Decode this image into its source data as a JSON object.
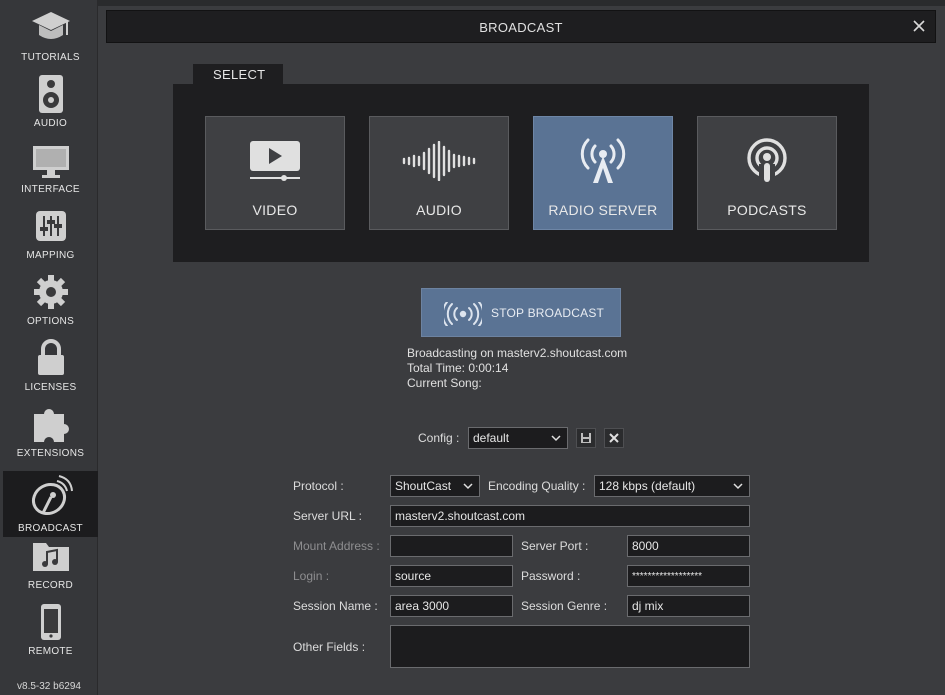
{
  "sidebar": {
    "items": [
      {
        "label": "TUTORIALS",
        "icon": "graduation-cap-icon"
      },
      {
        "label": "AUDIO",
        "icon": "speaker-icon"
      },
      {
        "label": "INTERFACE",
        "icon": "monitor-icon"
      },
      {
        "label": "MAPPING",
        "icon": "sliders-icon"
      },
      {
        "label": "OPTIONS",
        "icon": "gear-icon"
      },
      {
        "label": "LICENSES",
        "icon": "lock-icon"
      },
      {
        "label": "EXTENSIONS",
        "icon": "puzzle-icon"
      },
      {
        "label": "BROADCAST",
        "icon": "satellite-dish-icon"
      },
      {
        "label": "RECORD",
        "icon": "music-folder-icon"
      },
      {
        "label": "REMOTE",
        "icon": "phone-icon"
      }
    ],
    "active": "BROADCAST",
    "version": "v8.5-32 b6294"
  },
  "header": {
    "title": "BROADCAST",
    "close_icon": "close-icon"
  },
  "select": {
    "tab_label": "SELECT",
    "tiles": [
      {
        "label": "VIDEO",
        "icon": "video-play-icon"
      },
      {
        "label": "AUDIO",
        "icon": "waveform-icon"
      },
      {
        "label": "RADIO SERVER",
        "icon": "radio-tower-icon"
      },
      {
        "label": "PODCASTS",
        "icon": "podcast-icon"
      }
    ],
    "active": "RADIO SERVER"
  },
  "broadcast": {
    "button_label": "STOP BROADCAST",
    "status": "Broadcasting on masterv2.shoutcast.com",
    "total_time": "Total Time: 0:00:14",
    "current_song": "Current Song:"
  },
  "config": {
    "label": "Config :",
    "value": "default"
  },
  "form": {
    "protocol_label": "Protocol :",
    "protocol_value": "ShoutCast",
    "quality_label": "Encoding Quality :",
    "quality_value": "128 kbps (default)",
    "server_url_label": "Server URL :",
    "server_url_value": "masterv2.shoutcast.com",
    "mount_label": "Mount Address :",
    "mount_value": "",
    "port_label": "Server Port :",
    "port_value": "8000",
    "login_label": "Login :",
    "login_value": "source",
    "password_label": "Password :",
    "password_value": "******************",
    "session_name_label": "Session Name :",
    "session_name_value": "area 3000",
    "session_genre_label": "Session Genre :",
    "session_genre_value": "dj mix",
    "other_label": "Other Fields :",
    "other_value": ""
  },
  "colors": {
    "accent": "#5a7394",
    "panel": "#1e1e20",
    "background": "#3b3c3f"
  }
}
